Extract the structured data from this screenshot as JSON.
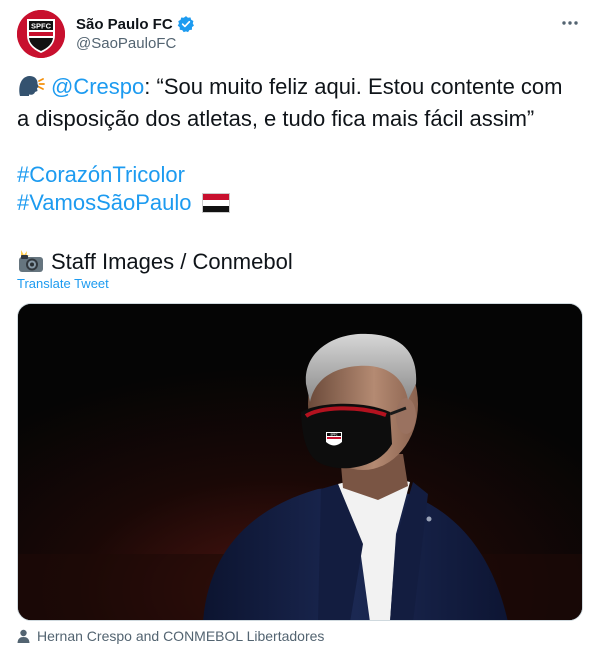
{
  "author": {
    "display_name": "São Paulo FC",
    "handle": "@SaoPauloFC",
    "avatar_text": "SPFC",
    "verified_icon": "verified-badge-icon"
  },
  "tweet": {
    "mention": "@Crespo",
    "quote_line1": ": “Sou muito feliz aqui. Estou contente com",
    "quote_line2": "a disposição dos atletas, e tudo fica mais fácil assim”",
    "hashtag1": "#CorazónTricolor",
    "hashtag2": "#VamosSãoPaulo",
    "credit": "Staff Images / Conmebol",
    "translate_label": "Translate Tweet"
  },
  "media": {
    "tagged_people": "Hernan Crespo and CONMEBOL Libertadores",
    "mask_badge_text": "SPFC"
  },
  "icons": {
    "speaking_head": "speaking-head-icon",
    "camera_flash": "camera-flash-icon",
    "flag": "flag-icon",
    "more": "more-icon",
    "person": "person-icon"
  },
  "colors": {
    "link": "#1d9bf0",
    "text": "#0f1419",
    "secondary": "#536471",
    "brand_red": "#c8102e"
  }
}
